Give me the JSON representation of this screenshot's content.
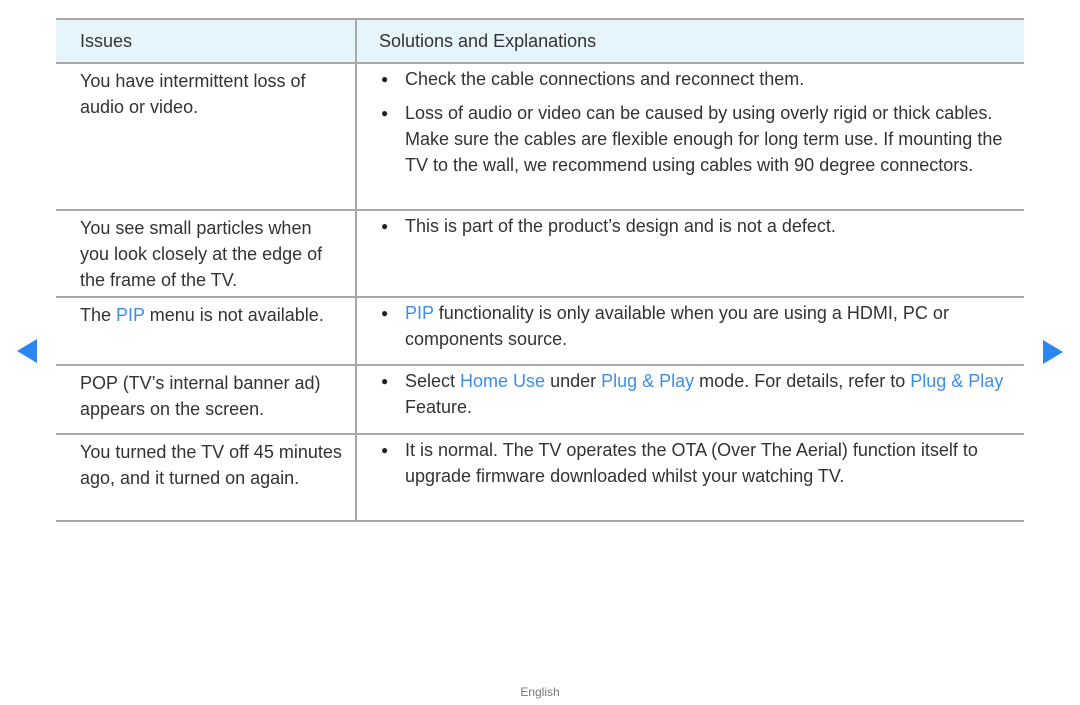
{
  "table": {
    "headers": {
      "issues": "Issues",
      "solutions": "Solutions and Explanations"
    },
    "rows": [
      {
        "issue": [
          {
            "text": "You have intermittent loss of audio or video.",
            "highlight": false
          }
        ],
        "solutions": [
          [
            {
              "text": "Check the cable connections and reconnect them.",
              "highlight": false
            }
          ],
          [
            {
              "text": "Loss of audio or video can be caused by using overly rigid or thick cables. Make sure the cables are flexible enough for long term use. If mounting the TV to the wall, we recommend using cables with 90 degree connectors.",
              "highlight": false
            }
          ]
        ]
      },
      {
        "issue": [
          {
            "text": "You see small particles when you look closely at the edge of the frame of the TV.",
            "highlight": false
          }
        ],
        "solutions": [
          [
            {
              "text": "This is part of the product’s design and is not a defect.",
              "highlight": false
            }
          ]
        ]
      },
      {
        "issue": [
          {
            "text": "The ",
            "highlight": false
          },
          {
            "text": "PIP",
            "highlight": true
          },
          {
            "text": " menu is not available.",
            "highlight": false
          }
        ],
        "solutions": [
          [
            {
              "text": "PIP",
              "highlight": true
            },
            {
              "text": " functionality is only available when you are using a HDMI, PC or components source.",
              "highlight": false
            }
          ]
        ]
      },
      {
        "issue": [
          {
            "text": "POP (TV’s internal banner ad) appears on the screen.",
            "highlight": false
          }
        ],
        "solutions": [
          [
            {
              "text": "Select ",
              "highlight": false
            },
            {
              "text": "Home Use",
              "highlight": true
            },
            {
              "text": " under ",
              "highlight": false
            },
            {
              "text": "Plug & Play",
              "highlight": true
            },
            {
              "text": " mode. For details, refer to ",
              "highlight": false
            },
            {
              "text": "Plug & Play",
              "highlight": true
            },
            {
              "text": " Feature.",
              "highlight": false
            }
          ]
        ]
      },
      {
        "issue": [
          {
            "text": "You turned the TV off 45 minutes ago, and it turned on again.",
            "highlight": false
          }
        ],
        "solutions": [
          [
            {
              "text": "It is normal. The TV operates the OTA (Over The Aerial) function itself to upgrade firmware downloaded whilst your watching TV.",
              "highlight": false
            }
          ]
        ]
      }
    ]
  },
  "navigation": {
    "prev_icon": "left-triangle-arrow",
    "next_icon": "right-triangle-arrow"
  },
  "footer": {
    "language": "English"
  },
  "colors": {
    "highlight": "#3d8ee8",
    "header_bg": "#e6f5fb",
    "arrow": "#2b86f0",
    "border": "#a8a8a8"
  }
}
